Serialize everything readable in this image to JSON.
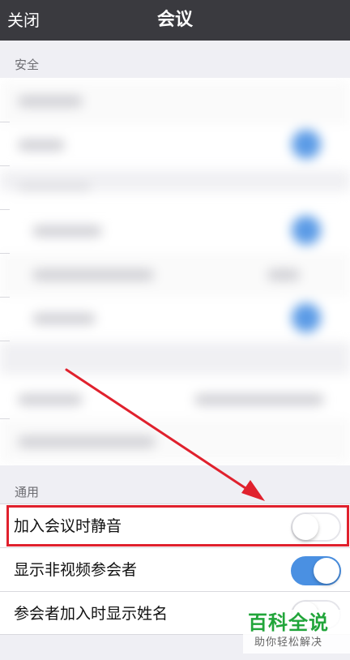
{
  "navbar": {
    "close_label": "关闭",
    "title": "会议"
  },
  "sections": {
    "security_header": "安全",
    "general_header": "通用"
  },
  "settings": {
    "rows": [
      {
        "label": "加入会议时静音",
        "enabled": false
      },
      {
        "label": "显示非视频参会者",
        "enabled": true
      },
      {
        "label": "参会者加入时显示姓名",
        "enabled": false
      }
    ]
  },
  "colors": {
    "accent": "#4a90e2",
    "highlight": "#e0212d",
    "navbar": "#3a3a3f"
  },
  "watermark": {
    "title": "百科全说",
    "subtitle": "助你轻松解决"
  }
}
